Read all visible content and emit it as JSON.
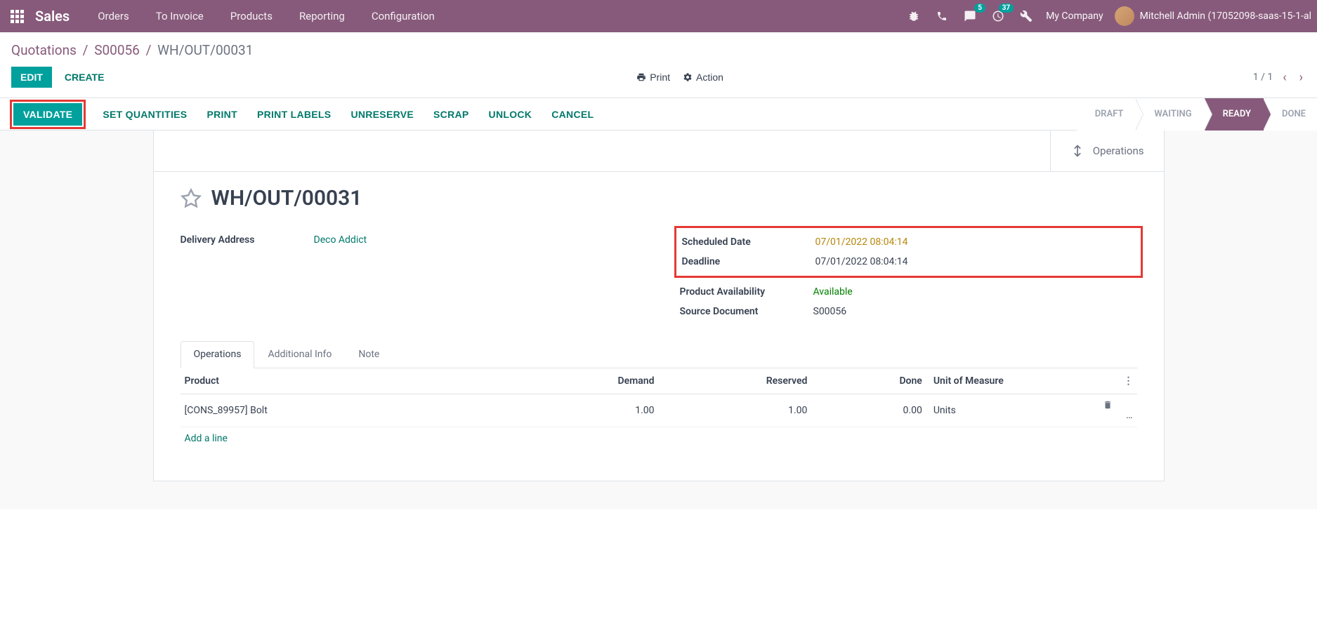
{
  "nav": {
    "brand": "Sales",
    "items": [
      "Orders",
      "To Invoice",
      "Products",
      "Reporting",
      "Configuration"
    ],
    "msg_badge": "5",
    "activity_badge": "37",
    "company": "My Company",
    "user": "Mitchell Admin (17052098-saas-15-1-al"
  },
  "breadcrumb": {
    "p1": "Quotations",
    "p2": "S00056",
    "p3": "WH/OUT/00031"
  },
  "ctrl": {
    "edit": "EDIT",
    "create": "CREATE",
    "print": "Print",
    "action": "Action",
    "pager": "1 / 1"
  },
  "actions": {
    "validate": "VALIDATE",
    "set_qty": "SET QUANTITIES",
    "print": "PRINT",
    "print_labels": "PRINT LABELS",
    "unreserve": "UNRESERVE",
    "scrap": "SCRAP",
    "unlock": "UNLOCK",
    "cancel": "CANCEL"
  },
  "status_steps": [
    "DRAFT",
    "WAITING",
    "READY",
    "DONE"
  ],
  "status_active_index": 2,
  "ops_button": "Operations",
  "record": {
    "title": "WH/OUT/00031",
    "left": {
      "delivery_addr_label": "Delivery Address",
      "delivery_addr_value": "Deco Addict"
    },
    "right": {
      "sched_label": "Scheduled Date",
      "sched_value": "07/01/2022 08:04:14",
      "deadline_label": "Deadline",
      "deadline_value": "07/01/2022 08:04:14",
      "avail_label": "Product Availability",
      "avail_value": "Available",
      "src_label": "Source Document",
      "src_value": "S00056"
    }
  },
  "tabs": [
    "Operations",
    "Additional Info",
    "Note"
  ],
  "table": {
    "headers": {
      "product": "Product",
      "demand": "Demand",
      "reserved": "Reserved",
      "done": "Done",
      "uom": "Unit of Measure"
    },
    "row": {
      "product": "[CONS_89957] Bolt",
      "demand": "1.00",
      "reserved": "1.00",
      "done": "0.00",
      "uom": "Units"
    },
    "add_line": "Add a line"
  }
}
